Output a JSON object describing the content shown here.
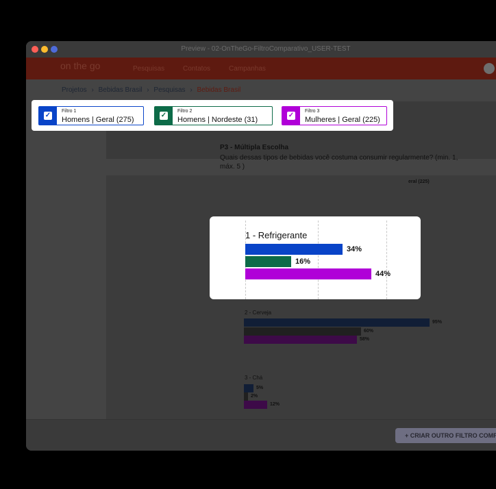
{
  "window": {
    "title": "Preview - 02-OnTheGo-FiltroComparativo_USER-TEST",
    "dots": [
      "#ff5f57",
      "#febc2e",
      "#4e6bd9"
    ]
  },
  "nav": {
    "logo": "on the go",
    "links": [
      "Pesquisas",
      "Contatos",
      "Campanhas"
    ]
  },
  "breadcrumb": {
    "items": [
      "Projetos",
      "Bebidas Brasil",
      "Pesquisas",
      "Bebidas Brasil"
    ],
    "separator": "›"
  },
  "filters": [
    {
      "label": "Filtro 1",
      "value": "Homens | Geral (275)",
      "color": "#0944c8",
      "checked": true
    },
    {
      "label": "Filtro 2",
      "value": "Homens | Nordeste (31)",
      "color": "#0d6b48",
      "checked": true
    },
    {
      "label": "Filtro 3",
      "value": "Mulheres | Geral (225)",
      "color": "#b000d8",
      "checked": true
    }
  ],
  "question": {
    "title": "P3 - Múltipla Escolha",
    "text": "Quais dessas tipos de bebidas você costuma consumir regularmente? (min. 1, máx. 5 )",
    "legend_fragment": "eral (225)"
  },
  "chart_data": {
    "type": "bar",
    "categories": [
      "1 - Refrigerante",
      "2 - Cerveja",
      "3 - Chá"
    ],
    "series": [
      {
        "name": "Homens | Geral (275)",
        "values": [
          34,
          95,
          5
        ]
      },
      {
        "name": "Homens | Nordeste (31)",
        "values": [
          16,
          60,
          2
        ]
      },
      {
        "name": "Mulheres | Geral (225)",
        "values": [
          44,
          58,
          12
        ]
      }
    ],
    "value_labels": [
      [
        "34%",
        "16%",
        "44%"
      ],
      [
        "95%",
        "60%",
        "58%"
      ],
      [
        "5%",
        "2%",
        "12%"
      ]
    ],
    "xlim": [
      0,
      100
    ],
    "orientation": "horizontal"
  },
  "footer": {
    "create_button": "+  CRIAR OUTRO FILTRO COMPARATIVO"
  }
}
